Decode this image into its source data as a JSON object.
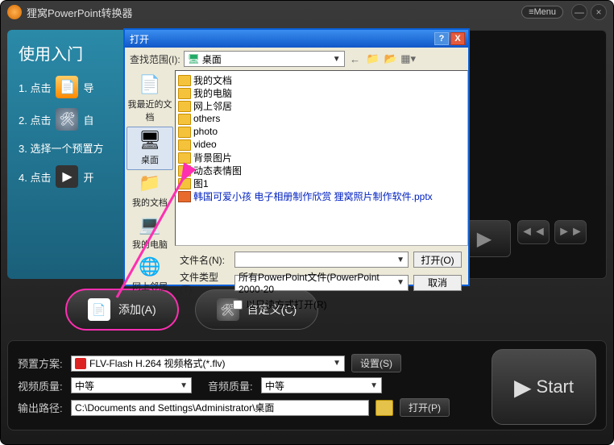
{
  "app": {
    "title": "狸窝PowerPoint转换器",
    "menu_label": "≡Menu"
  },
  "sidebar": {
    "heading": "使用入门",
    "step1_prefix": "1. 点击",
    "step1_suffix": "导",
    "step2_prefix": "2. 点击",
    "step2_suffix": "自",
    "step3": "3. 选择一个预置方",
    "step4_prefix": "4. 点击",
    "step4_suffix": "开"
  },
  "actions": {
    "add": "添加(A)",
    "custom": "自定义(C)"
  },
  "bottom": {
    "preset_label": "预置方案:",
    "preset_value": "FLV-Flash H.264 视频格式(*.flv)",
    "settings_btn": "设置(S)",
    "vq_label": "视频质量:",
    "vq_value": "中等",
    "aq_label": "音频质量:",
    "aq_value": "中等",
    "out_label": "输出路径:",
    "out_value": "C:\\Documents and Settings\\Administrator\\桌面",
    "open_btn": "打开(P)",
    "start_btn": "Start"
  },
  "dialog": {
    "title": "打开",
    "range_label": "查找范围(I):",
    "range_value": "桌面",
    "places": {
      "recent": "我最近的文档",
      "desktop": "桌面",
      "mydocs": "我的文档",
      "mycomp": "我的电脑",
      "network": "网上邻居"
    },
    "items": [
      {
        "icon": "folderx",
        "label": "我的文档"
      },
      {
        "icon": "folderx",
        "label": "我的电脑"
      },
      {
        "icon": "folderx",
        "label": "网上邻居"
      },
      {
        "icon": "folder",
        "label": "others"
      },
      {
        "icon": "folder",
        "label": "photo"
      },
      {
        "icon": "folder",
        "label": "video"
      },
      {
        "icon": "folder",
        "label": "背景图片"
      },
      {
        "icon": "folder",
        "label": "动态表情图"
      },
      {
        "icon": "folder",
        "label": "图1"
      },
      {
        "icon": "ppt",
        "label": "韩国可爱小孩 电子相册制作欣赏 狸窝照片制作软件.pptx",
        "blue": true
      }
    ],
    "file_label": "文件名(N):",
    "file_value": "",
    "type_label": "文件类型(T):",
    "type_value": "所有PowerPoint文件(PowerPoint 2000-20",
    "open_btn": "打开(O)",
    "cancel_btn": "取消",
    "readonly": "以只读方式打开(R)"
  }
}
